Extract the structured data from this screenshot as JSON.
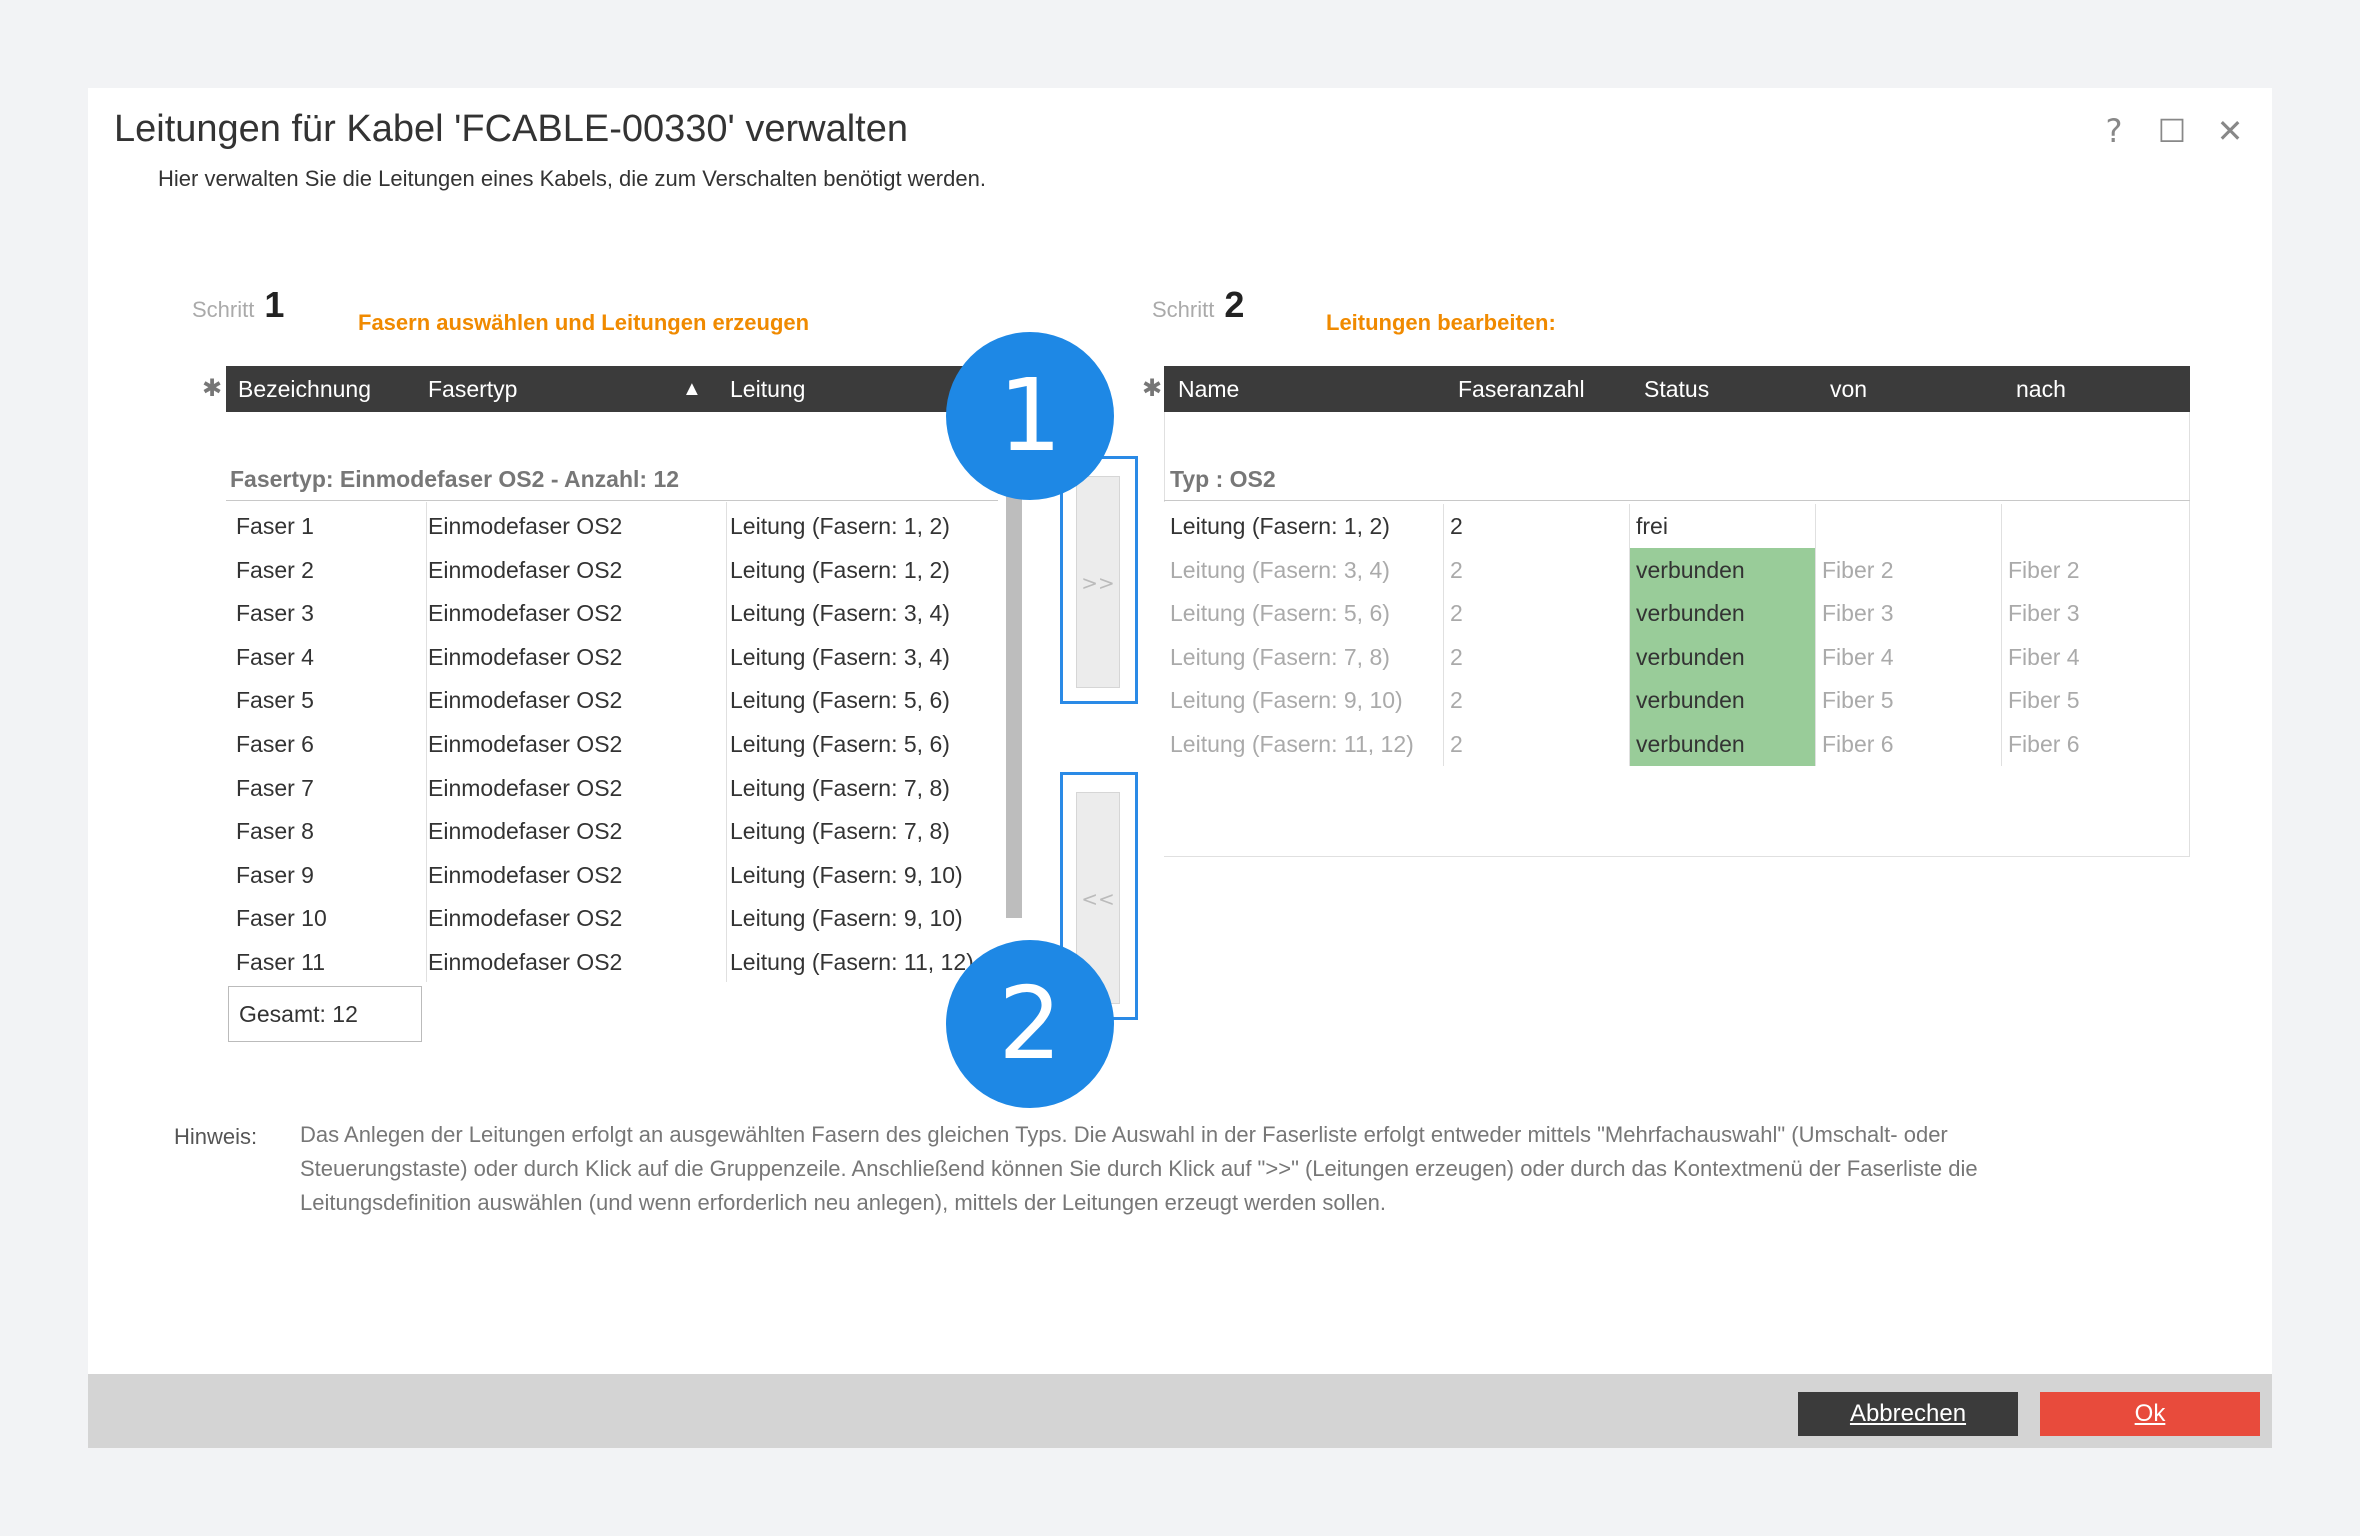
{
  "window": {
    "title": "Leitungen für Kabel 'FCABLE-00330' verwalten",
    "subtitle": "Hier verwalten Sie die Leitungen eines Kabels, die zum Verschalten benötigt werden.",
    "help": "?",
    "maximize": "☐",
    "close": "✕"
  },
  "step1": {
    "label": "Schritt",
    "number": "1",
    "title": "Fasern auswählen und Leitungen erzeugen",
    "columns": [
      "Bezeichnung",
      "Fasertyp",
      "Leitung"
    ],
    "group": "Fasertyp: Einmodefaser OS2 - Anzahl: 12",
    "rows": [
      [
        "Faser  1",
        "Einmodefaser OS2",
        "Leitung (Fasern: 1, 2)"
      ],
      [
        "Faser  2",
        "Einmodefaser OS2",
        "Leitung (Fasern: 1, 2)"
      ],
      [
        "Faser  3",
        "Einmodefaser OS2",
        "Leitung (Fasern: 3, 4)"
      ],
      [
        "Faser  4",
        "Einmodefaser OS2",
        "Leitung (Fasern: 3, 4)"
      ],
      [
        "Faser  5",
        "Einmodefaser OS2",
        "Leitung (Fasern: 5, 6)"
      ],
      [
        "Faser  6",
        "Einmodefaser OS2",
        "Leitung (Fasern: 5, 6)"
      ],
      [
        "Faser  7",
        "Einmodefaser OS2",
        "Leitung (Fasern: 7, 8)"
      ],
      [
        "Faser  8",
        "Einmodefaser OS2",
        "Leitung (Fasern: 7, 8)"
      ],
      [
        "Faser  9",
        "Einmodefaser OS2",
        "Leitung (Fasern: 9, 10)"
      ],
      [
        "Faser 10",
        "Einmodefaser OS2",
        "Leitung (Fasern: 9, 10)"
      ],
      [
        "Faser 11",
        "Einmodefaser OS2",
        "Leitung (Fasern: 11, 12)"
      ]
    ],
    "total": "Gesamt: 12"
  },
  "transfer": {
    "add_label": ">>",
    "remove_label": "<<"
  },
  "badges": [
    "1",
    "2"
  ],
  "step2": {
    "label": "Schritt",
    "number": "2",
    "title": "Leitungen bearbeiten:",
    "columns": [
      "Name",
      "Faseranzahl",
      "Status",
      "von",
      "nach"
    ],
    "group": "Typ : OS2",
    "rows": [
      {
        "name": "Leitung (Fasern: 1, 2)",
        "count": "2",
        "status": "frei",
        "von": "",
        "nach": "",
        "dim": false
      },
      {
        "name": "Leitung (Fasern: 3, 4)",
        "count": "2",
        "status": "verbunden",
        "von": "Fiber 2",
        "nach": "Fiber 2",
        "dim": true
      },
      {
        "name": "Leitung (Fasern: 5, 6)",
        "count": "2",
        "status": "verbunden",
        "von": "Fiber 3",
        "nach": "Fiber 3",
        "dim": true
      },
      {
        "name": "Leitung (Fasern: 7, 8)",
        "count": "2",
        "status": "verbunden",
        "von": "Fiber 4",
        "nach": "Fiber 4",
        "dim": true
      },
      {
        "name": "Leitung (Fasern: 9, 10)",
        "count": "2",
        "status": "verbunden",
        "von": "Fiber 5",
        "nach": "Fiber 5",
        "dim": true
      },
      {
        "name": "Leitung (Fasern: 11, 12)",
        "count": "2",
        "status": "verbunden",
        "von": "Fiber 6",
        "nach": "Fiber 6",
        "dim": true
      }
    ]
  },
  "hint": {
    "label": "Hinweis:",
    "text": "Das Anlegen der Leitungen erfolgt an ausgewählten Fasern des gleichen Typs. Die Auswahl in der Faserliste erfolgt entweder mittels \"Mehrfachauswahl\" (Umschalt- oder Steuerungstaste) oder durch Klick auf die Gruppenzeile. Anschließend können Sie durch Klick auf \">>\" (Leitungen erzeugen) oder durch das Kontextmenü der Faserliste die Leitungsdefinition auswählen (und wenn erforderlich neu anlegen), mittels der Leitungen erzeugt werden sollen."
  },
  "footer": {
    "cancel": "Abbrechen",
    "ok": "Ok"
  },
  "colors": {
    "accent": "#f08a00",
    "header": "#3b3b3b",
    "connected": "#99cc99",
    "ok": "#e84b3c",
    "cancel": "#3b3b3b",
    "badge": "#1e88e5"
  }
}
